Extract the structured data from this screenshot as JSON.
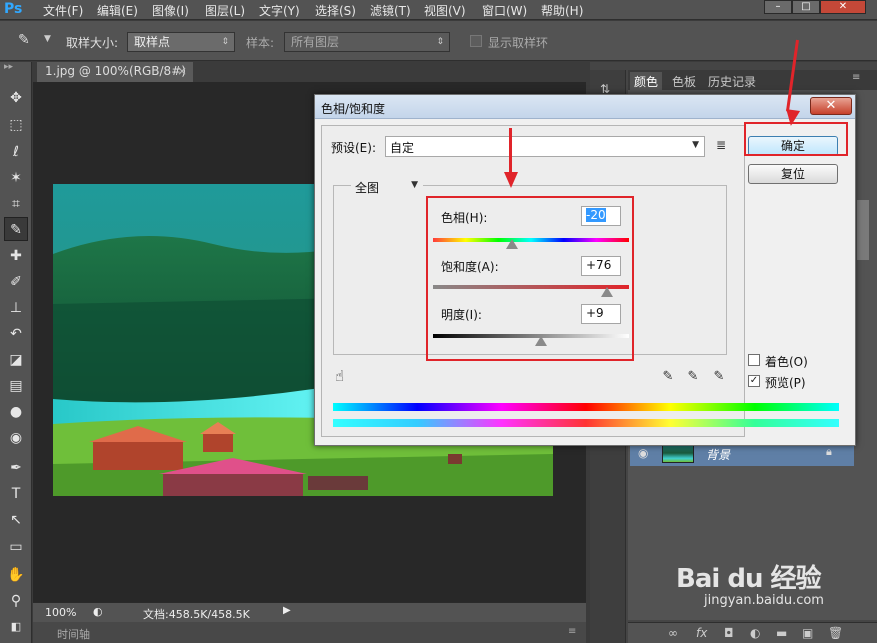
{
  "app": {
    "logo": "Ps"
  },
  "menu": [
    "文件(F)",
    "编辑(E)",
    "图像(I)",
    "图层(L)",
    "文字(Y)",
    "选择(S)",
    "滤镜(T)",
    "视图(V)",
    "窗口(W)",
    "帮助(H)"
  ],
  "window_controls": [
    "minimize-icon",
    "restore-icon",
    "close-icon"
  ],
  "options_bar": {
    "sample_size_label": "取样大小:",
    "sample_size_value": "取样点",
    "sample_label": "样本:",
    "sample_value": "所有图层",
    "show_ring_label": "显示取样环"
  },
  "document": {
    "tab_title": "1.jpg @ 100%(RGB/8#)",
    "zoom": "100%",
    "doc_info": "文档:458.5K/458.5K",
    "timeline_label": "时间轴"
  },
  "panels": {
    "tabs": [
      "颜色",
      "色板",
      "历史记录"
    ],
    "active_tab": 0,
    "layer_name": "背景"
  },
  "dialog": {
    "title": "色相/饱和度",
    "preset_label": "预设(E):",
    "preset_value": "自定",
    "channel_value": "全图",
    "hue_label": "色相(H):",
    "hue_value": "-20",
    "saturation_label": "饱和度(A):",
    "saturation_value": "+76",
    "lightness_label": "明度(I):",
    "lightness_value": "+9",
    "ok_label": "确定",
    "reset_label": "复位",
    "colorize_label": "着色(O)",
    "colorize_checked": false,
    "preview_label": "预览(P)",
    "preview_checked": true
  },
  "watermark": {
    "brand": "Bai du 经验",
    "url": "jingyan.baidu.com"
  },
  "colors": {
    "accent": "#e0242a",
    "ps_blue": "#31a8ff"
  }
}
